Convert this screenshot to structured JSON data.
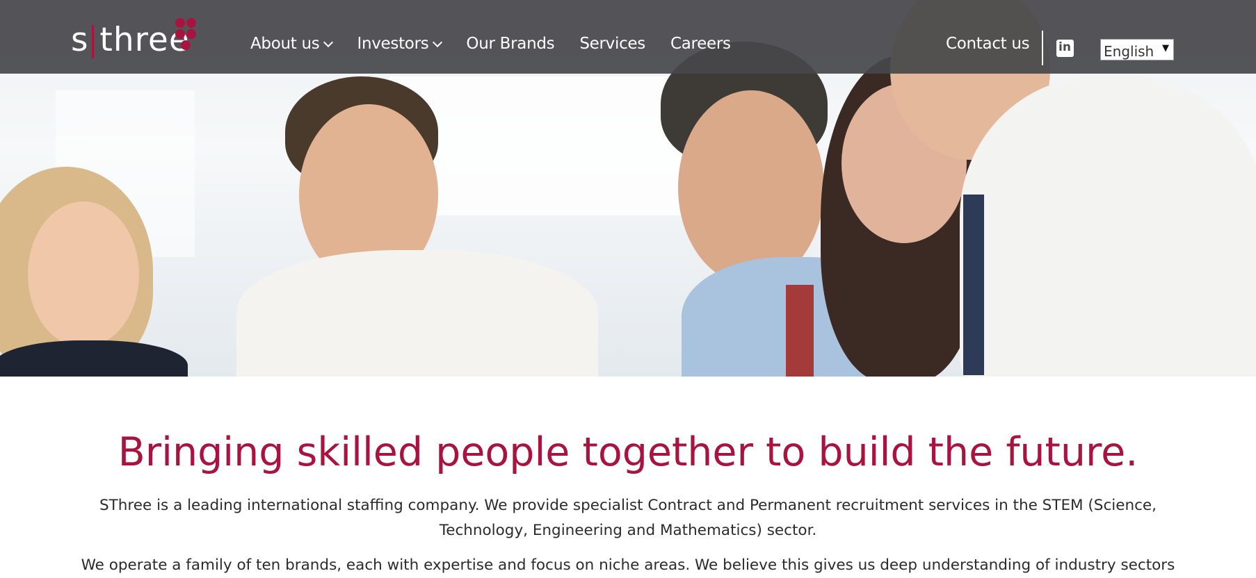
{
  "brand": {
    "logo_text": "s three",
    "accent_color": "#a8133f"
  },
  "header": {
    "background": "#46464a",
    "nav": [
      {
        "label": "About us",
        "has_dropdown": true
      },
      {
        "label": "Investors",
        "has_dropdown": true
      },
      {
        "label": "Our Brands",
        "has_dropdown": false
      },
      {
        "label": "Services",
        "has_dropdown": false
      },
      {
        "label": "Careers",
        "has_dropdown": false
      }
    ],
    "contact_label": "Contact us",
    "social_icon": "linkedin-icon",
    "linkedin_glyph": "in",
    "language": {
      "selected": "English",
      "arrow": "▼"
    }
  },
  "hero": {
    "icon": "team-photo"
  },
  "main": {
    "headline": "Bringing skilled people together to build the future.",
    "intro_paragraph": "SThree is a leading international staffing company. We provide specialist Contract and Permanent recruitment services in the STEM (Science, Technology, Engineering and Mathematics) sector.",
    "second_paragraph": "We operate a family of ten brands, each with expertise and focus on niche areas. We believe this gives us deep understanding of industry sectors"
  }
}
